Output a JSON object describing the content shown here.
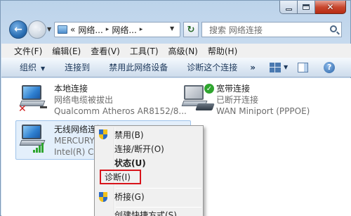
{
  "window": {
    "caption_buttons": {
      "minimize_icon": "minimize-icon",
      "maximize_icon": "maximize-icon",
      "close_glyph": "✕"
    }
  },
  "nav": {
    "back_glyph": "←",
    "forward_glyph": "→",
    "breadcrumb": [
      "«",
      "网络...",
      "网络...",
      ""
    ],
    "breadcrumb_sep": "▸",
    "refresh_glyph": "↻",
    "search_placeholder": "搜索 网络连接"
  },
  "menubar": [
    "文件(F)",
    "编辑(E)",
    "查看(V)",
    "工具(T)",
    "高级(N)",
    "帮助(H)"
  ],
  "commandbar": {
    "organize": "组织",
    "connect": "连接到",
    "disable": "禁用此网络设备",
    "diagnose": "诊断这个连接",
    "more": "»",
    "help": "?"
  },
  "connections": [
    {
      "name": "本地连接",
      "status": "网络电缆被拔出",
      "device": "Qualcomm Atheros AR8152/8..."
    },
    {
      "name": "宽带连接",
      "status": "已断开连接",
      "device": "WAN Miniport (PPPOE)"
    },
    {
      "name": "无线网络连接",
      "status": "MERCURY_",
      "device": "Intel(R) Ce"
    }
  ],
  "context_menu": {
    "items": [
      {
        "label": "禁用(B)",
        "shield": true
      },
      {
        "label": "连接/断开(O)",
        "shield": false
      },
      {
        "label": "状态(U)",
        "shield": false,
        "bold": true
      },
      {
        "label": "诊断(I)",
        "shield": false,
        "highlighted_box": true
      },
      {
        "label": "桥接(G)",
        "shield": true
      },
      {
        "label": "创建快捷方式(S)",
        "shield": false
      }
    ],
    "highlight_color": "#d8141b"
  },
  "colors": {
    "title_gradient": "#c7daee",
    "selection_bg": "#e3effb",
    "command_text": "#1e395b"
  }
}
